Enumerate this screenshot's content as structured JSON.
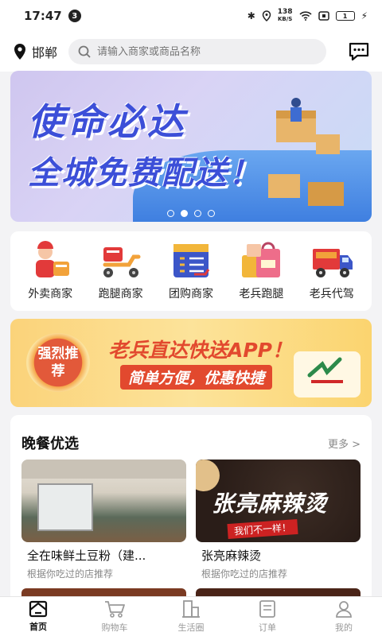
{
  "status_bar": {
    "time": "17:47",
    "notification_count": "3",
    "net_speed_value": "138",
    "net_speed_unit": "KB/S",
    "battery": "1"
  },
  "header": {
    "city": "邯郸",
    "search_placeholder": "请输入商家或商品名称"
  },
  "banner": {
    "line1": "使命必达",
    "line2": "全城免费配送！",
    "slides": 4,
    "active_slide": 2
  },
  "categories": [
    {
      "label": "外卖商家",
      "icon": "delivery-person-icon"
    },
    {
      "label": "跑腿商家",
      "icon": "scooter-icon"
    },
    {
      "label": "团购商家",
      "icon": "group-buy-menu-icon"
    },
    {
      "label": "老兵跑腿",
      "icon": "shopping-bag-icon"
    },
    {
      "label": "老兵代驾",
      "icon": "truck-icon"
    }
  ],
  "promo": {
    "badge": "强烈推荐",
    "headline": "老兵直达快送APP！",
    "subline": "简单方便，优惠快捷",
    "logo_text": "老兵直达快送"
  },
  "dinner_section": {
    "title": "晚餐优选",
    "more": "更多 >",
    "cards": [
      {
        "name": "全在味鲜土豆粉（建...",
        "sub": "根据你吃过的店推荐"
      },
      {
        "name": "张亮麻辣烫",
        "sub": "根据你吃过的店推荐",
        "image_text": "张亮麻辣烫",
        "image_slogan": "我们不一样！"
      }
    ]
  },
  "tabbar": [
    {
      "label": "首页",
      "icon": "home-icon",
      "active": true
    },
    {
      "label": "购物车",
      "icon": "cart-icon",
      "active": false
    },
    {
      "label": "生活圈",
      "icon": "buildings-icon",
      "active": false
    },
    {
      "label": "订单",
      "icon": "order-icon",
      "active": false
    },
    {
      "label": "我的",
      "icon": "user-icon",
      "active": false
    }
  ],
  "colors": {
    "accent_blue": "#3c4fd8",
    "promo_red": "#e2492e",
    "promo_yellow": "#fbd37a"
  }
}
